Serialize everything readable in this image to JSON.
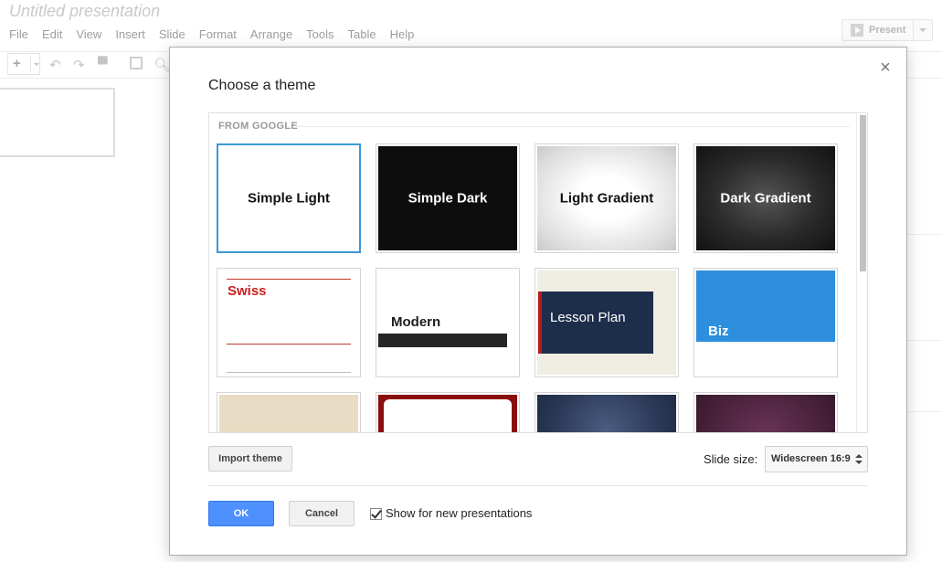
{
  "app": {
    "doc_title": "Untitled presentation",
    "menu": [
      "File",
      "Edit",
      "View",
      "Insert",
      "Slide",
      "Format",
      "Arrange",
      "Tools",
      "Table",
      "Help"
    ],
    "present_label": "Present",
    "add_symbol": "+"
  },
  "dialog": {
    "title": "Choose a theme",
    "close_symbol": "×",
    "section_label": "FROM GOOGLE",
    "themes": [
      {
        "name": "Simple Light"
      },
      {
        "name": "Simple Dark"
      },
      {
        "name": "Light Gradient"
      },
      {
        "name": "Dark Gradient"
      },
      {
        "name": "Swiss"
      },
      {
        "name": "Modern"
      },
      {
        "name": "Lesson Plan"
      },
      {
        "name": "Biz"
      }
    ],
    "import_label": "Import theme",
    "slide_size_label": "Slide size:",
    "slide_size_value": "Widescreen 16:9",
    "ok_label": "OK",
    "cancel_label": "Cancel",
    "show_label": "Show for new presentations",
    "show_checked": true
  },
  "colors": {
    "selection": "#3b98d8",
    "primary_button": "#4d90fe",
    "swiss_red": "#cc1f1f",
    "biz_blue": "#2d8fdd",
    "lesson_navy": "#1d2e4b"
  }
}
